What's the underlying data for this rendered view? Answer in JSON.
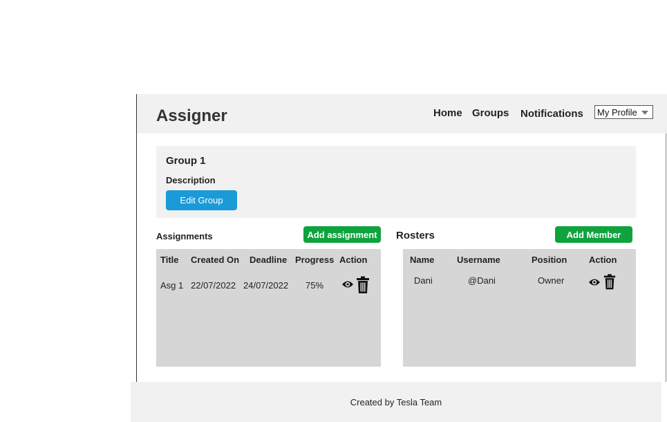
{
  "header": {
    "app_title": "Assigner",
    "nav": [
      "Home",
      "Groups",
      "Notifications"
    ],
    "profile_select": "My Profile"
  },
  "group": {
    "name": "Group 1",
    "description_label": "Description",
    "edit_button": "Edit Group"
  },
  "assignments": {
    "title": "Assignments",
    "add_button": "Add assignment",
    "columns": [
      "Title",
      "Created On",
      "Deadline",
      "Progress",
      "Action"
    ],
    "rows": [
      {
        "title": "Asg 1",
        "created_on": "22/07/2022",
        "deadline": "24/07/2022",
        "progress": "75%",
        "actions": [
          "eye-icon",
          "trash-icon"
        ]
      }
    ]
  },
  "rosters": {
    "title": "Rosters",
    "add_button": "Add Member",
    "columns": [
      "Name",
      "Username",
      "Position",
      "Action"
    ],
    "rows": [
      {
        "name": "Dani",
        "username": "@Dani",
        "position": "Owner",
        "actions": [
          "eye-icon",
          "trash-icon"
        ]
      }
    ]
  },
  "footer": {
    "text": "Created by Tesla Team"
  },
  "colors": {
    "accent_blue": "#1a9bd7",
    "accent_green": "#0fa33e",
    "panel_bg": "#f1f1f1",
    "table_bg": "#d6d6d6"
  }
}
